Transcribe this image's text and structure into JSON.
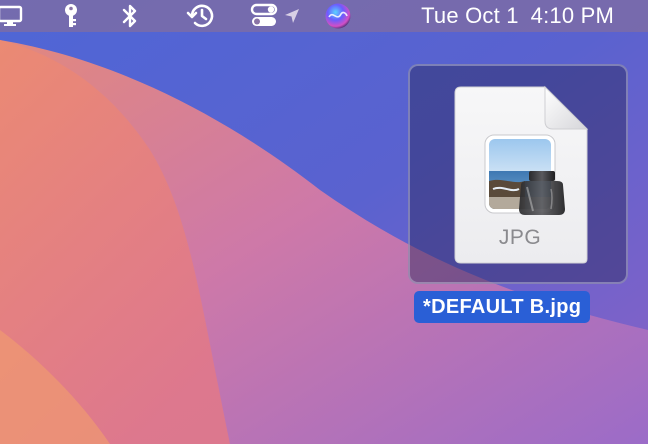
{
  "menubar": {
    "icons": [
      "display-icon",
      "key-icon",
      "bluetooth-icon",
      "time-machine-icon",
      "control-center-icon",
      "location-arrow-icon",
      "siri-icon"
    ],
    "clock": {
      "date": "Tue Oct 1",
      "time": "4:10 PM"
    }
  },
  "desktop": {
    "selected_file": {
      "name": "*DEFAULT B.jpg",
      "type_badge": "JPG",
      "selected": true
    }
  },
  "colors": {
    "selection_label_bg": "#2a5fd6",
    "menubar_bg": "#826ea0"
  }
}
